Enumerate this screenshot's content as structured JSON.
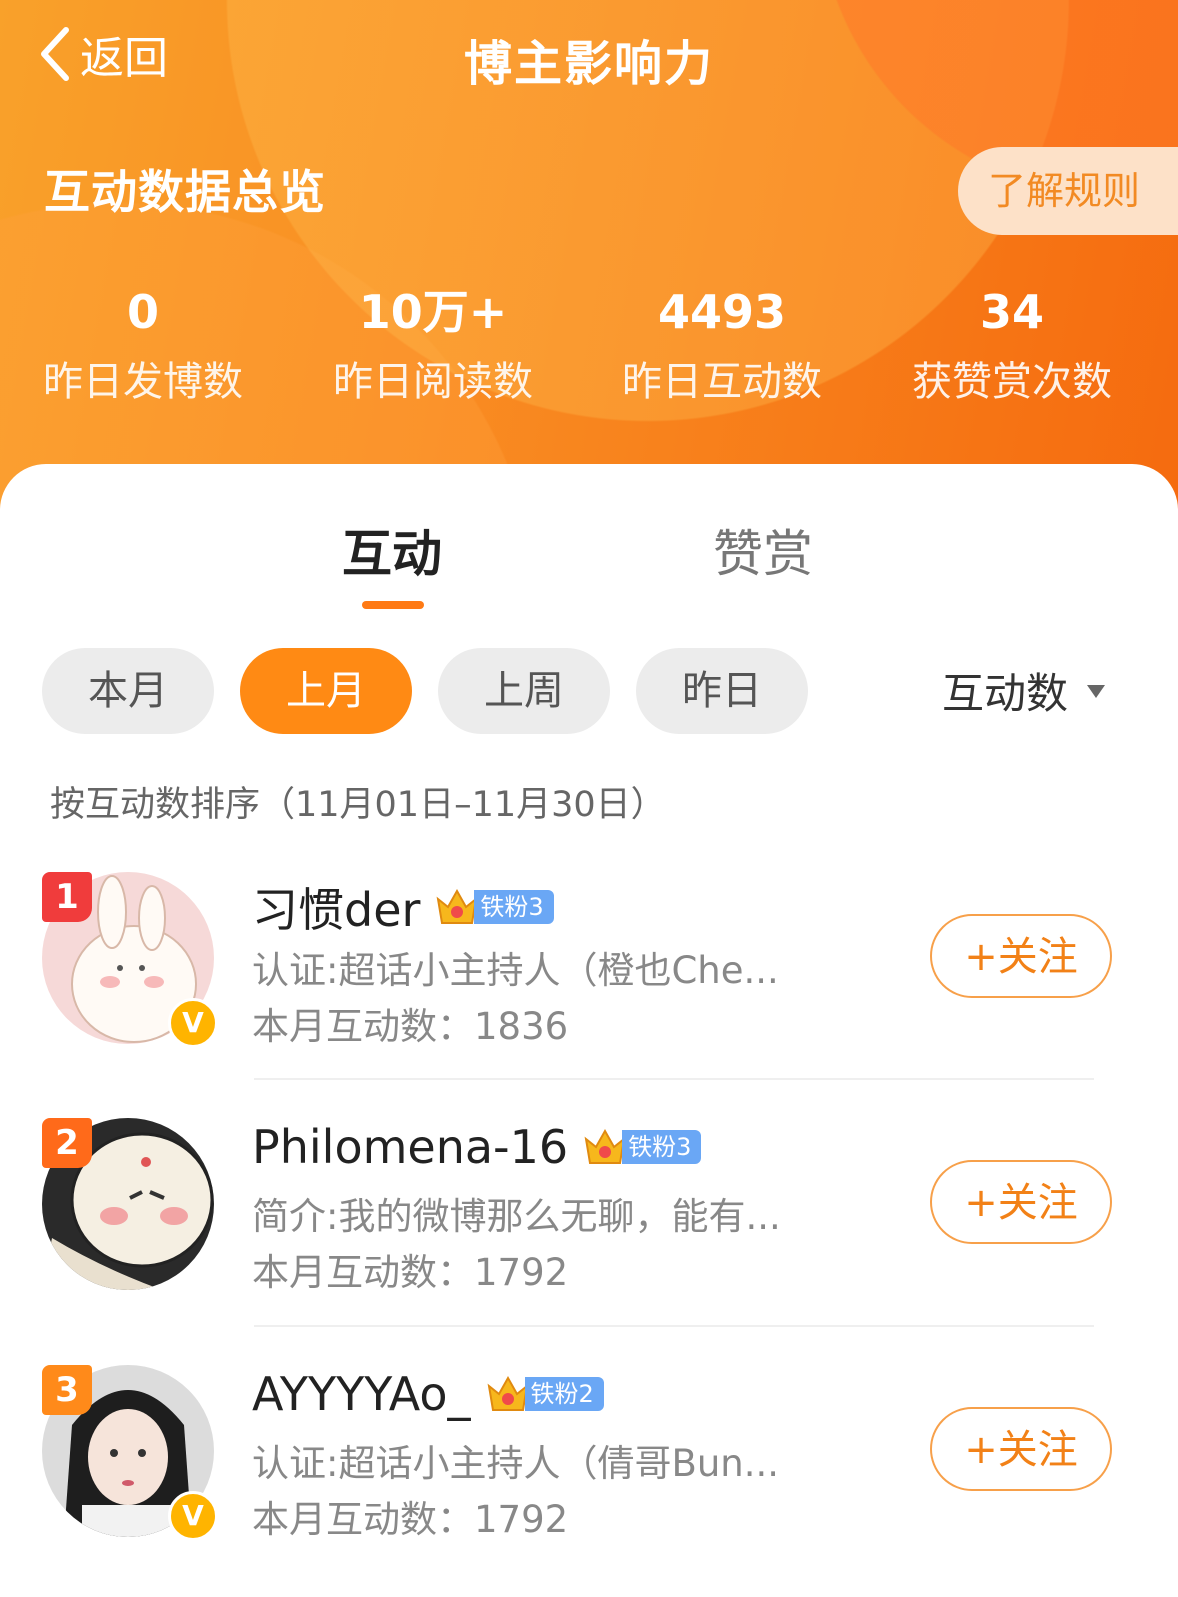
{
  "nav": {
    "back_label": "返回",
    "title": "博主影响力"
  },
  "overview": {
    "title": "互动数据总览",
    "rules_button": "了解规则",
    "stats": [
      {
        "value": "0",
        "label": "昨日发博数"
      },
      {
        "value": "10万+",
        "label": "昨日阅读数"
      },
      {
        "value": "4493",
        "label": "昨日互动数"
      },
      {
        "value": "34",
        "label": "获赞赏次数"
      }
    ]
  },
  "tabs": [
    {
      "label": "互动",
      "active": true
    },
    {
      "label": "赞赏",
      "active": false
    }
  ],
  "filters": {
    "periods": [
      {
        "label": "本月"
      },
      {
        "label": "上月",
        "active": true
      },
      {
        "label": "上周"
      },
      {
        "label": "昨日"
      }
    ],
    "sort_label": "互动数",
    "range_note": "按互动数排序（11月01日–11月30日）"
  },
  "users": [
    {
      "rank": "1",
      "name": "习惯der",
      "fan_level": "铁粉3",
      "crown_level": "3",
      "desc": "认证:超话小主持人（橙也Che...",
      "count_label": "本月互动数：",
      "count": "1836",
      "verified": true,
      "rank_color": "#f03c3c",
      "follow_label": "+关注"
    },
    {
      "rank": "2",
      "name": "Philomena-16",
      "fan_level": "铁粉3",
      "crown_level": "2",
      "desc": "简介:我的微博那么无聊，能有...",
      "count_label": "本月互动数：",
      "count": "1792",
      "verified": false,
      "rank_color": "#ff6a1a",
      "follow_label": "+关注"
    },
    {
      "rank": "3",
      "name": "AYYYYAo_",
      "fan_level": "铁粉2",
      "crown_level": "3",
      "desc": "认证:超话小主持人（倩哥Bun...",
      "count_label": "本月互动数：",
      "count": "1792",
      "verified": true,
      "rank_color": "#ff8a1a",
      "follow_label": "+关注"
    }
  ]
}
